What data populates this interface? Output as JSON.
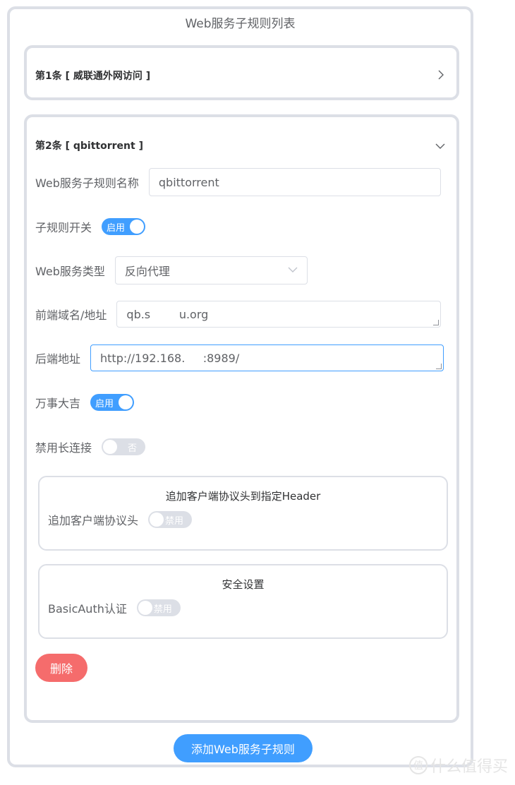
{
  "list_title": "Web服务子规则列表",
  "items": [
    {
      "title": "第1条 [ 威联通外网访问 ]",
      "expanded": false
    },
    {
      "title": "第2条 [ qbittorrent ]",
      "expanded": true
    }
  ],
  "form": {
    "name_label": "Web服务子规则名称",
    "name_value": "qbittorrent",
    "enable_label": "子规则开关",
    "enable_text": "启用",
    "type_label": "Web服务类型",
    "type_value": "反向代理",
    "frontend_label": "前端域名/地址",
    "frontend_value": "qb.s        u.org",
    "backend_label": "后端地址",
    "backend_value": "http://192.168.     :8989/",
    "wanshi_label": "万事大吉",
    "wanshi_text": "启用",
    "keepalive_label": "禁用长连接",
    "keepalive_text": "否"
  },
  "header_box": {
    "title": "追加客户端协议头到指定Header",
    "label": "追加客户端协议头",
    "switch_text": "禁用"
  },
  "security_box": {
    "title": "安全设置",
    "label": "BasicAuth认证",
    "switch_text": "禁用"
  },
  "delete_label": "删除",
  "add_label": "添加Web服务子规则",
  "watermark": "什么值得买",
  "watermark_glyph": "值",
  "colors": {
    "primary": "#409eff",
    "danger": "#f56c6c",
    "border": "#dcdfe6"
  }
}
